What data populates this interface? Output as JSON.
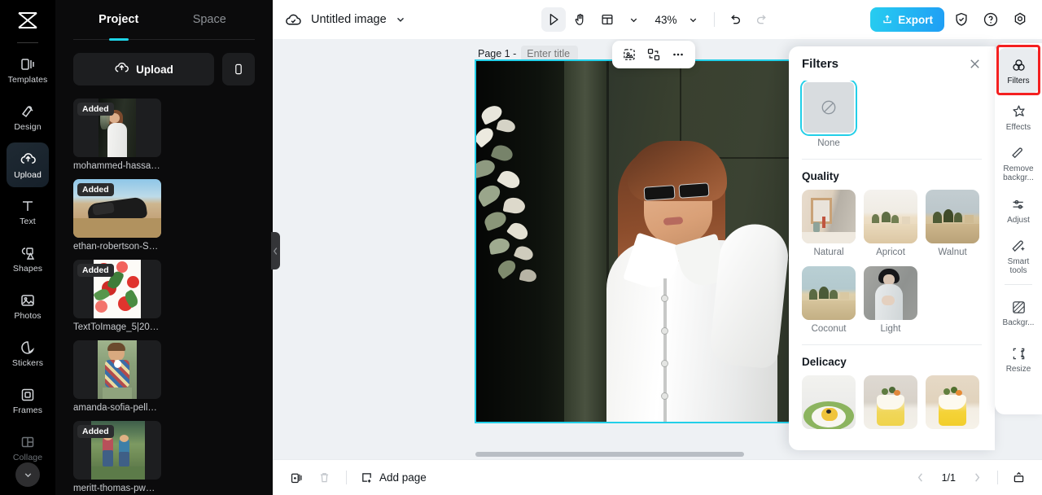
{
  "app": {
    "logo_icon": "capcut-logo-icon"
  },
  "left_rail": {
    "items": [
      {
        "label": "Templates",
        "icon": "templates-icon",
        "active": false
      },
      {
        "label": "Design",
        "icon": "design-icon",
        "active": false
      },
      {
        "label": "Upload",
        "icon": "upload-cloud-icon",
        "active": true
      },
      {
        "label": "Text",
        "icon": "text-icon",
        "active": false
      },
      {
        "label": "Shapes",
        "icon": "shapes-icon",
        "active": false
      },
      {
        "label": "Photos",
        "icon": "photos-icon",
        "active": false
      },
      {
        "label": "Stickers",
        "icon": "stickers-icon",
        "active": false
      },
      {
        "label": "Frames",
        "icon": "frames-icon",
        "active": false
      },
      {
        "label": "Collage",
        "icon": "collage-icon",
        "active": false
      }
    ],
    "expand_icon": "chevron-down-icon"
  },
  "project_panel": {
    "tabs": [
      {
        "label": "Project",
        "active": true
      },
      {
        "label": "Space",
        "active": false
      }
    ],
    "upload_button": "Upload",
    "upload_icon": "upload-cloud-icon",
    "mobile_upload_icon": "mobile-phone-icon",
    "collapse_icon": "chevron-left-icon",
    "uploads": [
      {
        "name": "mohammed-hassan-...",
        "badge": "Added"
      },
      {
        "name": "ethan-robertson-SYx...",
        "badge": "Added"
      },
      {
        "name": "TextToImage_5|2023...",
        "badge": "Added"
      },
      {
        "name": "amanda-sofia-pellen...",
        "badge": ""
      },
      {
        "name": "meritt-thomas-pwCJ...",
        "badge": "Added"
      }
    ]
  },
  "topbar": {
    "cloud_icon": "cloud-saved-icon",
    "doc_title": "Untitled image",
    "title_caret_icon": "chevron-down-icon",
    "select_tool_icon": "cursor-select-icon",
    "hand_tool_icon": "hand-pan-icon",
    "layout_tool_icon": "layout-grid-icon",
    "layout_caret_icon": "chevron-down-icon",
    "zoom_value": "43%",
    "zoom_caret_icon": "chevron-down-icon",
    "undo_icon": "undo-arrow-icon",
    "redo_icon": "redo-arrow-icon",
    "export_label": "Export",
    "export_icon": "export-share-icon",
    "export_color": "#22cdee",
    "shield_icon": "shield-check-icon",
    "help_icon": "question-circle-icon",
    "settings_icon": "gear-icon"
  },
  "canvas": {
    "page_label": "Page 1 -",
    "page_title_placeholder": "Enter title",
    "selection_color": "#22cfe8",
    "float_tools": [
      {
        "icon": "cutout-select-icon"
      },
      {
        "icon": "swap-replace-icon"
      },
      {
        "icon": "more-options-icon"
      }
    ]
  },
  "filters_panel": {
    "title": "Filters",
    "close_icon": "close-icon",
    "none": {
      "label": "None",
      "icon": "no-filter-icon",
      "selected": true
    },
    "sections": [
      {
        "title": "Quality",
        "items": [
          {
            "label": "Natural"
          },
          {
            "label": "Apricot"
          },
          {
            "label": "Walnut"
          },
          {
            "label": "Coconut"
          },
          {
            "label": "Light"
          }
        ]
      },
      {
        "title": "Delicacy",
        "items": [
          {
            "label": ""
          },
          {
            "label": ""
          },
          {
            "label": ""
          }
        ]
      }
    ]
  },
  "tool_rail": {
    "highlight_color": "#f42020",
    "items": [
      {
        "label": "Filters",
        "icon": "filters-circles-icon",
        "active": true
      },
      {
        "label": "Effects",
        "icon": "effects-star-icon",
        "active": false
      },
      {
        "label": "Remove backgr...",
        "icon": "remove-background-icon",
        "active": false
      },
      {
        "label": "Adjust",
        "icon": "adjust-sliders-icon",
        "active": false
      },
      {
        "label": "Smart tools",
        "icon": "smart-tools-wand-icon",
        "active": false
      },
      {
        "label": "Backgr...",
        "icon": "background-icon",
        "active": false
      },
      {
        "label": "Resize",
        "icon": "resize-icon",
        "active": false
      }
    ]
  },
  "bottombar": {
    "duplicate_icon": "duplicate-page-icon",
    "delete_icon": "trash-icon",
    "add_page_label": "Add page",
    "add_page_icon": "add-page-icon",
    "prev_icon": "chevron-left-icon",
    "page_indicator": "1/1",
    "next_icon": "chevron-right-icon",
    "present_icon": "present-icon"
  }
}
